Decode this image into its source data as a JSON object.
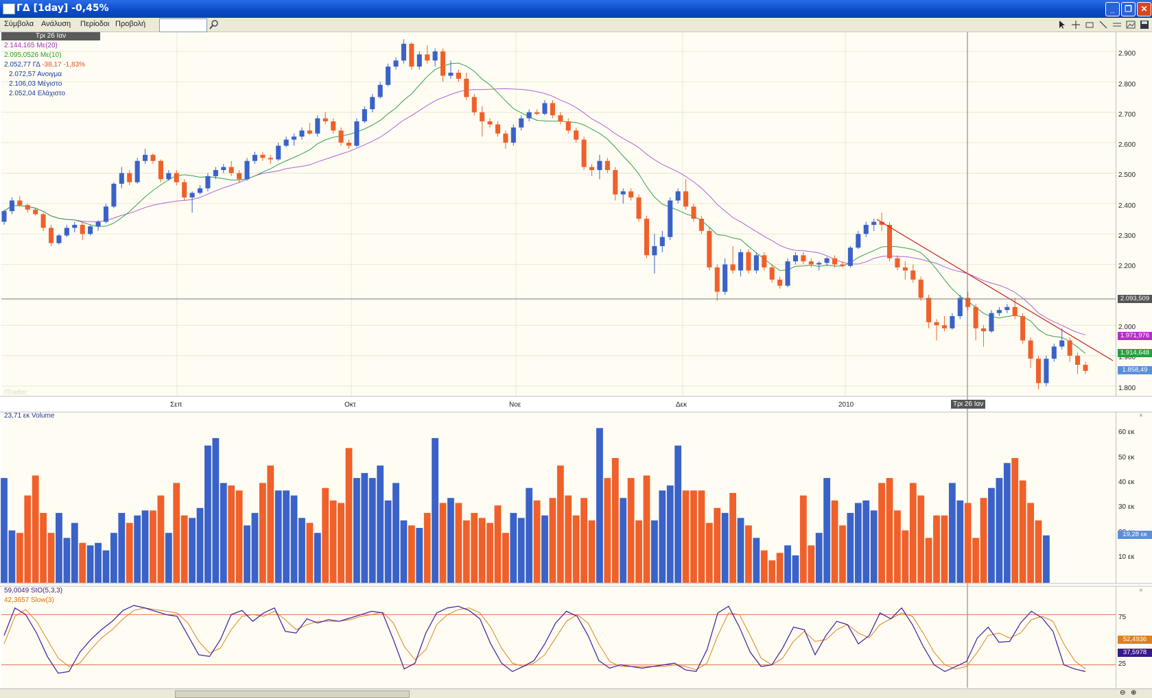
{
  "window": {
    "title": "ΓΔ [1day] -0,45%"
  },
  "menu": {
    "items": [
      "Σύμβολα",
      "Ανάλυση",
      "Περίοδοι",
      "Προβολή"
    ],
    "symbol_value": ""
  },
  "price_panel": {
    "date_chip": "Τρι 26 Ιαν",
    "legend": [
      {
        "value": "2.144,165",
        "label": "Με(20)",
        "color": "#a030c0"
      },
      {
        "value": "2.095,0526",
        "label": "Με(10)",
        "color": "#2a9a2a"
      },
      {
        "value": "2.052,77",
        "label": "ΓΔ",
        "extra": "-38,17 -1,83%",
        "color": "#1a3a9a"
      },
      {
        "value": "2.072,57",
        "label": "Ανοιγμα",
        "color": "#1a3a9a"
      },
      {
        "value": "2.106,03",
        "label": "Μέγιστο",
        "color": "#1a3a9a"
      },
      {
        "value": "2.052,04",
        "label": "Ελάχιστο",
        "color": "#1a3a9a"
      }
    ],
    "y_ticks": [
      "2.900",
      "2.800",
      "2.700",
      "2.600",
      "2.500",
      "2.400",
      "2.300",
      "2.200",
      "2.000",
      "1.900",
      "1.800"
    ],
    "x_labels": [
      "Σεπ",
      "Οκτ",
      "Νοε",
      "Δεκ",
      "2010"
    ],
    "cursor_label": "Τρι 26 Ιαν",
    "crosshair_value": "2.093,509",
    "badges": [
      {
        "text": "1.971,976",
        "color": "#b030c8"
      },
      {
        "text": "1.914,648",
        "color": "#22a040"
      },
      {
        "text": "1.858,49",
        "color": "#5b8fd8"
      }
    ],
    "watermark": "iTrader"
  },
  "volume_panel": {
    "legend": "23,71 εκ Volume",
    "y_ticks": [
      "60 εκ",
      "50 εκ",
      "40 εκ",
      "30 εκ",
      "20 εκ",
      "10 εκ"
    ],
    "badge": "19,28 εκ"
  },
  "stoch_panel": {
    "legend": [
      {
        "text": "59,0049 StO(5,3,3)",
        "color": "#3a1a8a"
      },
      {
        "text": "42,3657 Slow(3)",
        "color": "#d07010"
      }
    ],
    "y_ticks": [
      "75",
      "25"
    ],
    "badges": [
      {
        "text": "52,4936",
        "color": "#e08020"
      },
      {
        "text": "37,5978",
        "color": "#3a1a8a"
      }
    ]
  },
  "colors": {
    "up": "#3a62c8",
    "down": "#f0602a",
    "ma20": "#b060d8",
    "ma10": "#30a050",
    "trend": "#c02020"
  },
  "chart_data": {
    "type": "candlestick",
    "title": "ΓΔ [1day]",
    "candles": [
      [
        2340,
        2380,
        2330,
        2375
      ],
      [
        2375,
        2420,
        2365,
        2410
      ],
      [
        2410,
        2425,
        2390,
        2395
      ],
      [
        2395,
        2400,
        2370,
        2380
      ],
      [
        2380,
        2385,
        2360,
        2365
      ],
      [
        2365,
        2370,
        2310,
        2320
      ],
      [
        2320,
        2330,
        2260,
        2270
      ],
      [
        2270,
        2300,
        2265,
        2295
      ],
      [
        2295,
        2330,
        2290,
        2320
      ],
      [
        2320,
        2340,
        2305,
        2330
      ],
      [
        2330,
        2340,
        2280,
        2300
      ],
      [
        2300,
        2330,
        2295,
        2325
      ],
      [
        2325,
        2345,
        2310,
        2340
      ],
      [
        2340,
        2400,
        2335,
        2390
      ],
      [
        2390,
        2470,
        2385,
        2465
      ],
      [
        2465,
        2520,
        2450,
        2500
      ],
      [
        2500,
        2510,
        2460,
        2470
      ],
      [
        2470,
        2550,
        2465,
        2540
      ],
      [
        2540,
        2580,
        2530,
        2560
      ],
      [
        2560,
        2565,
        2530,
        2540
      ],
      [
        2540,
        2545,
        2470,
        2480
      ],
      [
        2480,
        2510,
        2475,
        2500
      ],
      [
        2500,
        2510,
        2460,
        2470
      ],
      [
        2470,
        2480,
        2410,
        2420
      ],
      [
        2420,
        2440,
        2370,
        2435
      ],
      [
        2435,
        2460,
        2430,
        2450
      ],
      [
        2450,
        2500,
        2440,
        2490
      ],
      [
        2490,
        2520,
        2480,
        2510
      ],
      [
        2510,
        2530,
        2500,
        2520
      ],
      [
        2520,
        2540,
        2490,
        2500
      ],
      [
        2500,
        2510,
        2470,
        2480
      ],
      [
        2480,
        2550,
        2475,
        2540
      ],
      [
        2540,
        2570,
        2530,
        2560
      ],
      [
        2560,
        2570,
        2540,
        2550
      ],
      [
        2550,
        2560,
        2530,
        2545
      ],
      [
        2545,
        2600,
        2540,
        2590
      ],
      [
        2590,
        2620,
        2585,
        2610
      ],
      [
        2610,
        2630,
        2590,
        2620
      ],
      [
        2620,
        2650,
        2610,
        2640
      ],
      [
        2640,
        2665,
        2625,
        2630
      ],
      [
        2630,
        2690,
        2620,
        2680
      ],
      [
        2680,
        2700,
        2660,
        2670
      ],
      [
        2670,
        2680,
        2630,
        2640
      ],
      [
        2640,
        2650,
        2590,
        2600
      ],
      [
        2600,
        2610,
        2580,
        2590
      ],
      [
        2590,
        2680,
        2585,
        2670
      ],
      [
        2670,
        2720,
        2665,
        2710
      ],
      [
        2710,
        2760,
        2700,
        2750
      ],
      [
        2750,
        2800,
        2745,
        2790
      ],
      [
        2790,
        2860,
        2785,
        2850
      ],
      [
        2850,
        2880,
        2840,
        2870
      ],
      [
        2870,
        2940,
        2860,
        2925
      ],
      [
        2925,
        2930,
        2840,
        2850
      ],
      [
        2850,
        2900,
        2840,
        2890
      ],
      [
        2890,
        2920,
        2860,
        2870
      ],
      [
        2870,
        2910,
        2850,
        2900
      ],
      [
        2900,
        2910,
        2800,
        2820
      ],
      [
        2820,
        2870,
        2810,
        2830
      ],
      [
        2830,
        2840,
        2800,
        2810
      ],
      [
        2810,
        2830,
        2740,
        2750
      ],
      [
        2750,
        2760,
        2690,
        2700
      ],
      [
        2700,
        2720,
        2620,
        2670
      ],
      [
        2670,
        2680,
        2650,
        2660
      ],
      [
        2660,
        2670,
        2620,
        2630
      ],
      [
        2630,
        2640,
        2580,
        2600
      ],
      [
        2600,
        2660,
        2590,
        2650
      ],
      [
        2650,
        2690,
        2640,
        2680
      ],
      [
        2680,
        2710,
        2670,
        2700
      ],
      [
        2700,
        2710,
        2690,
        2695
      ],
      [
        2695,
        2740,
        2690,
        2730
      ],
      [
        2730,
        2740,
        2680,
        2690
      ],
      [
        2690,
        2700,
        2660,
        2670
      ],
      [
        2670,
        2680,
        2630,
        2640
      ],
      [
        2640,
        2650,
        2600,
        2610
      ],
      [
        2610,
        2620,
        2510,
        2520
      ],
      [
        2520,
        2530,
        2490,
        2510
      ],
      [
        2510,
        2560,
        2480,
        2540
      ],
      [
        2540,
        2550,
        2500,
        2510
      ],
      [
        2510,
        2520,
        2410,
        2430
      ],
      [
        2430,
        2450,
        2400,
        2440
      ],
      [
        2440,
        2450,
        2410,
        2420
      ],
      [
        2420,
        2430,
        2340,
        2350
      ],
      [
        2350,
        2360,
        2220,
        2230
      ],
      [
        2230,
        2300,
        2170,
        2260
      ],
      [
        2260,
        2310,
        2240,
        2290
      ],
      [
        2290,
        2420,
        2280,
        2410
      ],
      [
        2410,
        2450,
        2400,
        2440
      ],
      [
        2440,
        2480,
        2380,
        2390
      ],
      [
        2390,
        2400,
        2340,
        2350
      ],
      [
        2350,
        2360,
        2300,
        2310
      ],
      [
        2310,
        2320,
        2180,
        2190
      ],
      [
        2190,
        2200,
        2080,
        2110
      ],
      [
        2110,
        2220,
        2100,
        2200
      ],
      [
        2200,
        2260,
        2170,
        2180
      ],
      [
        2180,
        2250,
        2160,
        2240
      ],
      [
        2240,
        2250,
        2170,
        2180
      ],
      [
        2180,
        2240,
        2170,
        2230
      ],
      [
        2230,
        2240,
        2180,
        2190
      ],
      [
        2190,
        2200,
        2140,
        2150
      ],
      [
        2150,
        2160,
        2120,
        2130
      ],
      [
        2130,
        2220,
        2125,
        2210
      ],
      [
        2210,
        2240,
        2200,
        2230
      ],
      [
        2230,
        2240,
        2200,
        2210
      ],
      [
        2210,
        2220,
        2190,
        2200
      ],
      [
        2200,
        2210,
        2180,
        2205
      ],
      [
        2205,
        2225,
        2195,
        2220
      ],
      [
        2220,
        2230,
        2190,
        2200
      ],
      [
        2200,
        2210,
        2190,
        2195
      ],
      [
        2195,
        2260,
        2190,
        2255
      ],
      [
        2255,
        2310,
        2250,
        2300
      ],
      [
        2300,
        2340,
        2290,
        2330
      ],
      [
        2330,
        2350,
        2310,
        2340
      ],
      [
        2340,
        2370,
        2310,
        2330
      ],
      [
        2330,
        2340,
        2210,
        2220
      ],
      [
        2220,
        2230,
        2180,
        2190
      ],
      [
        2190,
        2210,
        2150,
        2180
      ],
      [
        2180,
        2200,
        2140,
        2150
      ],
      [
        2150,
        2160,
        2080,
        2090
      ],
      [
        2090,
        2100,
        1990,
        2010
      ],
      [
        2010,
        2020,
        1950,
        2000
      ],
      [
        2000,
        2030,
        1980,
        1990
      ],
      [
        1990,
        2040,
        1985,
        2030
      ],
      [
        2030,
        2100,
        2020,
        2090
      ],
      [
        2090,
        2110,
        2050,
        2060
      ],
      [
        2060,
        2070,
        1950,
        1990
      ],
      [
        1990,
        2000,
        1930,
        1980
      ],
      [
        1980,
        2050,
        1975,
        2040
      ],
      [
        2040,
        2060,
        2030,
        2050
      ],
      [
        2050,
        2070,
        2040,
        2060
      ],
      [
        2060,
        2090,
        2020,
        2030
      ],
      [
        2030,
        2040,
        1940,
        1950
      ],
      [
        1950,
        1960,
        1860,
        1890
      ],
      [
        1890,
        1900,
        1790,
        1810
      ],
      [
        1810,
        1900,
        1800,
        1890
      ],
      [
        1890,
        1940,
        1880,
        1930
      ],
      [
        1930,
        1990,
        1920,
        1950
      ],
      [
        1950,
        1960,
        1880,
        1900
      ],
      [
        1900,
        1910,
        1840,
        1870
      ],
      [
        1870,
        1880,
        1840,
        1850
      ]
    ],
    "volume": [
      42,
      21,
      20,
      35,
      43,
      28,
      20,
      28,
      18,
      24,
      16,
      15,
      16,
      13,
      20,
      28,
      24,
      27,
      29,
      29,
      35,
      20,
      40,
      27,
      26,
      30,
      55,
      58,
      40,
      39,
      37,
      23,
      28,
      40,
      47,
      37,
      37,
      35,
      26,
      24,
      20,
      38,
      33,
      32,
      54,
      42,
      44,
      42,
      47,
      33,
      40,
      25,
      23,
      22,
      28,
      58,
      32,
      34,
      32,
      25,
      28,
      26,
      24,
      31,
      20,
      28,
      26,
      38,
      33,
      27,
      34,
      47,
      35,
      27,
      34,
      25,
      62,
      42,
      50,
      34,
      42,
      25,
      43,
      25,
      37,
      39,
      55,
      37,
      37,
      37,
      24,
      30,
      28,
      36,
      26,
      23,
      18,
      13,
      9,
      12,
      15,
      11,
      35,
      15,
      20,
      42,
      33,
      23,
      28,
      32,
      33,
      29,
      40,
      42,
      29,
      21,
      40,
      35,
      18,
      27,
      27,
      40,
      33,
      32,
      18,
      34,
      38,
      42,
      48,
      50,
      41,
      32,
      25,
      19
    ],
    "stoch_k": [
      55,
      88,
      80,
      58,
      30,
      10,
      12,
      35,
      50,
      62,
      72,
      85,
      91,
      88,
      84,
      80,
      78,
      55,
      32,
      30,
      50,
      80,
      85,
      72,
      82,
      88,
      60,
      58,
      75,
      70,
      74,
      72,
      76,
      80,
      84,
      82,
      50,
      15,
      22,
      58,
      82,
      88,
      90,
      85,
      75,
      45,
      22,
      12,
      18,
      25,
      45,
      70,
      84,
      78,
      55,
      25,
      16,
      20,
      18,
      16,
      18,
      20,
      22,
      14,
      12,
      38,
      82,
      90,
      65,
      35,
      18,
      20,
      40,
      65,
      62,
      32,
      55,
      72,
      68,
      45,
      55,
      82,
      75,
      88,
      68,
      42,
      20,
      12,
      18,
      24,
      52,
      65,
      47,
      48,
      70,
      84,
      76,
      60,
      20,
      15,
      12
    ],
    "stoch_d": [
      45,
      78,
      86,
      72,
      50,
      28,
      18,
      22,
      38,
      52,
      62,
      75,
      85,
      88,
      86,
      84,
      82,
      70,
      48,
      34,
      40,
      62,
      78,
      80,
      78,
      84,
      74,
      62,
      68,
      72,
      72,
      72,
      74,
      78,
      80,
      83,
      70,
      42,
      26,
      38,
      68,
      80,
      86,
      88,
      82,
      65,
      40,
      22,
      18,
      22,
      32,
      52,
      72,
      80,
      70,
      45,
      24,
      18,
      18,
      18,
      18,
      18,
      20,
      18,
      14,
      22,
      55,
      82,
      80,
      55,
      28,
      20,
      28,
      48,
      60,
      48,
      50,
      62,
      68,
      58,
      52,
      68,
      75,
      82,
      78,
      58,
      35,
      20,
      15,
      18,
      35,
      55,
      58,
      52,
      58,
      74,
      78,
      72,
      45,
      25,
      15
    ]
  }
}
